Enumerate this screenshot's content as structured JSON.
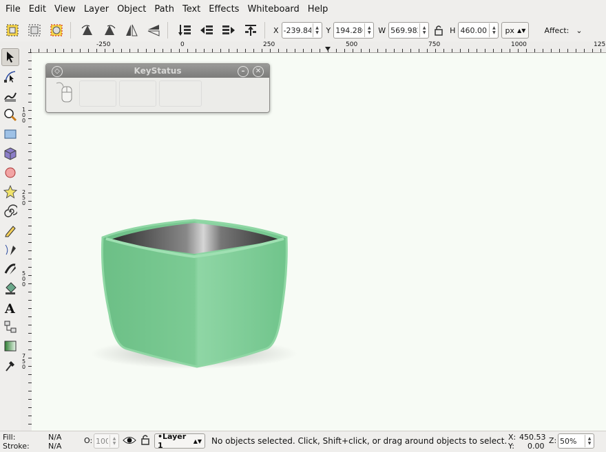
{
  "menubar": {
    "items": [
      {
        "label": "File"
      },
      {
        "label": "Edit"
      },
      {
        "label": "View"
      },
      {
        "label": "Layer"
      },
      {
        "label": "Object"
      },
      {
        "label": "Path"
      },
      {
        "label": "Text"
      },
      {
        "label": "Effects"
      },
      {
        "label": "Whiteboard"
      },
      {
        "label": "Help"
      }
    ]
  },
  "toolbar": {
    "x_label": "X",
    "x_value": "-239.846",
    "y_label": "Y",
    "y_value": "194.286",
    "w_label": "W",
    "w_value": "569.982",
    "h_label": "H",
    "h_value": "460.005",
    "unit": "px",
    "affect_label": "Affect:"
  },
  "ruler": {
    "top_labels": [
      "-250",
      "0",
      "250",
      "500",
      "750",
      "1000",
      "125"
    ],
    "left_labels": [
      "100",
      "250",
      "500",
      "750",
      "250"
    ]
  },
  "keystatus": {
    "title": "KeyStatus"
  },
  "statusbar": {
    "fill_label": "Fill:",
    "fill_value": "N/A",
    "stroke_label": "Stroke:",
    "stroke_value": "N/A",
    "opacity_label": "O:",
    "opacity_value": "100",
    "layer_name": "•Layer 1",
    "message": "No objects selected. Click, Shift+click, or drag around objects to select.",
    "x_label": "X:",
    "x_value": "450.53",
    "y_label": "Y:",
    "y_value": "0.00",
    "zoom_label": "Z:",
    "zoom_value": "50%"
  },
  "colors": {
    "canvas_bg": "#f7fbf5",
    "pot_green": "#79c791",
    "pot_inner_dark": "#2a2a2a"
  }
}
